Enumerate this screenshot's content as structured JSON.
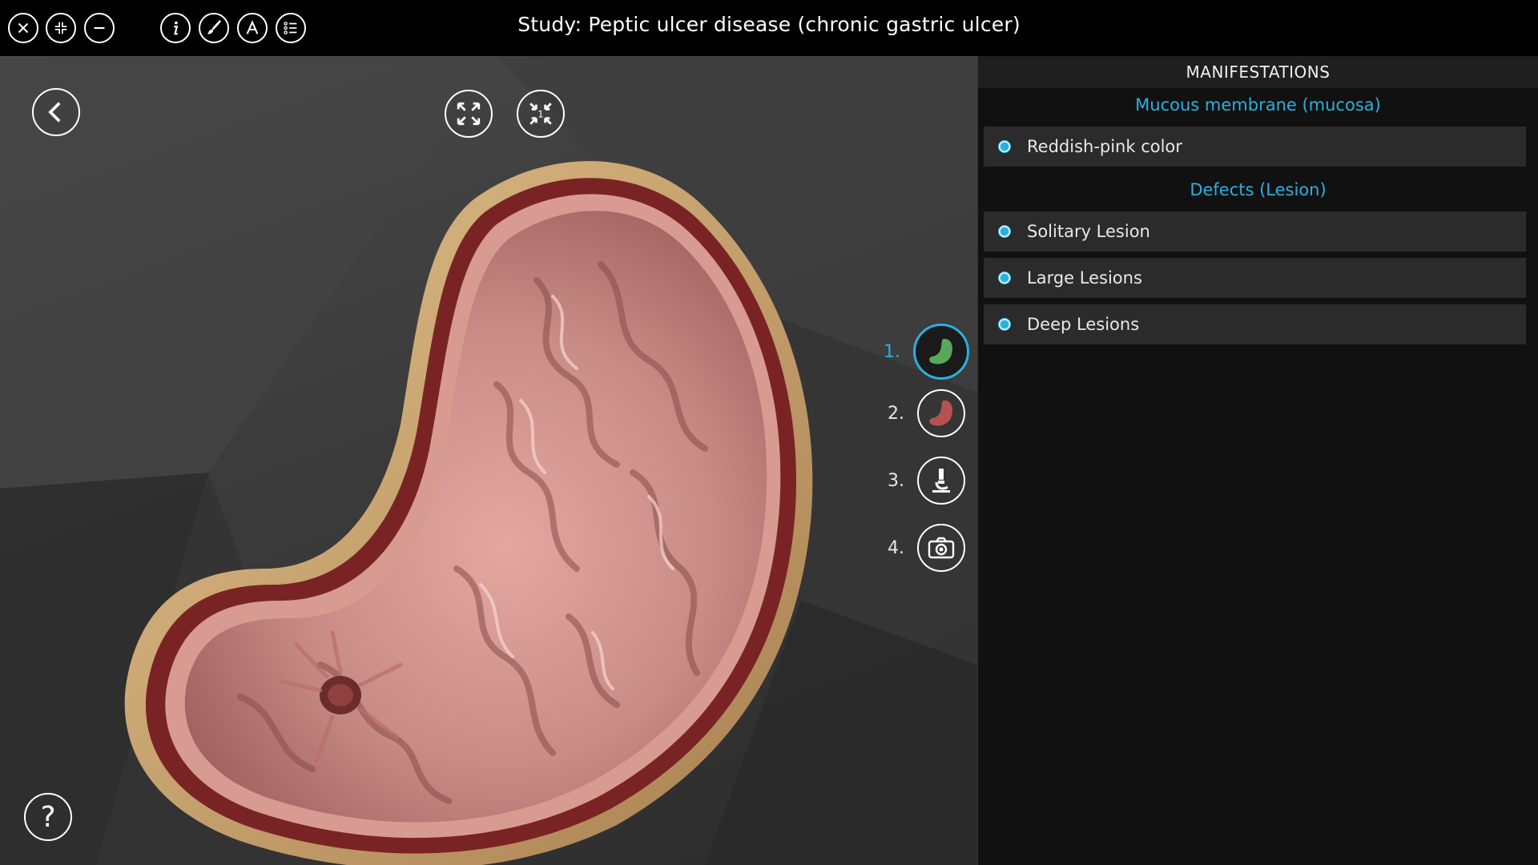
{
  "title": "Study: Peptic ulcer disease (chronic gastric ulcer)",
  "toolbar": {
    "left_buttons": [
      "close-icon",
      "shrink-icon",
      "minus-icon"
    ],
    "right_buttons": [
      "info-icon",
      "brush-icon",
      "text-a-icon",
      "list-icon"
    ]
  },
  "viewport": {
    "zoom_badge": "1",
    "views": [
      {
        "number": "1.",
        "icon": "stomach-green-icon",
        "active": true
      },
      {
        "number": "2.",
        "icon": "stomach-red-icon",
        "active": false
      },
      {
        "number": "3.",
        "icon": "microscope-icon",
        "active": false
      },
      {
        "number": "4.",
        "icon": "camera-icon",
        "active": false
      }
    ],
    "help_label": "?"
  },
  "panel": {
    "header": "MANIFESTATIONS",
    "sections": [
      {
        "title": "Mucous membrane (mucosa)",
        "items": [
          "Reddish-pink color"
        ]
      },
      {
        "title": "Defects (Lesion)",
        "items": [
          "Solitary Lesion",
          "Large Lesions",
          "Deep Lesions"
        ]
      }
    ]
  },
  "colors": {
    "accent": "#2ab0e0",
    "panel_bg": "#111111",
    "item_bg": "#2b2b2b"
  }
}
